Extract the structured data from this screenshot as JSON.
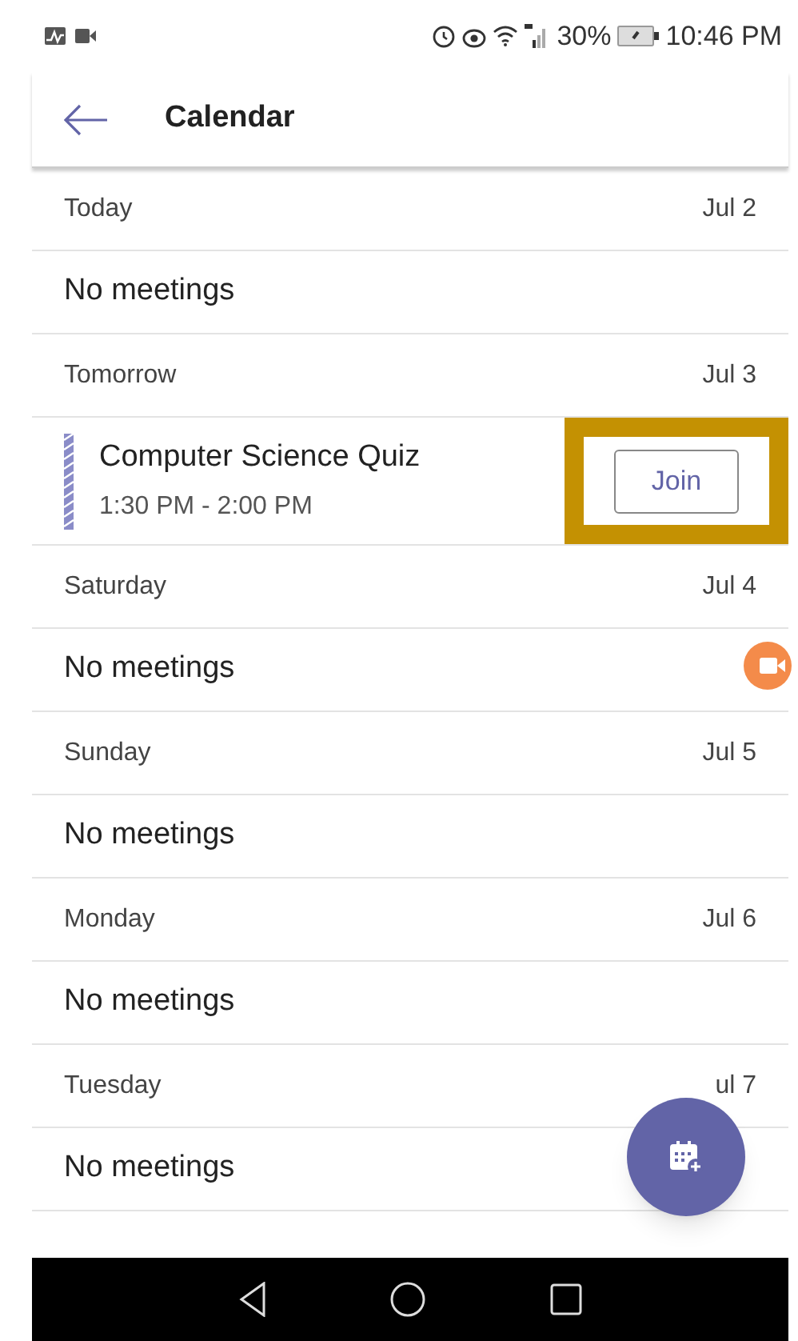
{
  "status_bar": {
    "battery": "30%",
    "time": "10:46 PM"
  },
  "header": {
    "title": "Calendar"
  },
  "days": [
    {
      "label": "Today",
      "date": "Jul 2",
      "entries": [
        {
          "kind": "empty",
          "text": "No meetings"
        }
      ]
    },
    {
      "label": "Tomorrow",
      "date": "Jul 3",
      "entries": [
        {
          "kind": "meeting",
          "title": "Computer Science Quiz",
          "time": "1:30 PM - 2:00 PM",
          "button": "Join",
          "highlighted": true
        }
      ]
    },
    {
      "label": "Saturday",
      "date": "Jul 4",
      "entries": [
        {
          "kind": "empty",
          "text": "No meetings"
        }
      ]
    },
    {
      "label": "Sunday",
      "date": "Jul 5",
      "entries": [
        {
          "kind": "empty",
          "text": "No meetings"
        }
      ]
    },
    {
      "label": "Monday",
      "date": "Jul 6",
      "entries": [
        {
          "kind": "empty",
          "text": "No meetings"
        }
      ]
    },
    {
      "label": "Tuesday",
      "date": "ul 7",
      "entries": [
        {
          "kind": "empty",
          "text": "No meetings"
        }
      ]
    }
  ]
}
